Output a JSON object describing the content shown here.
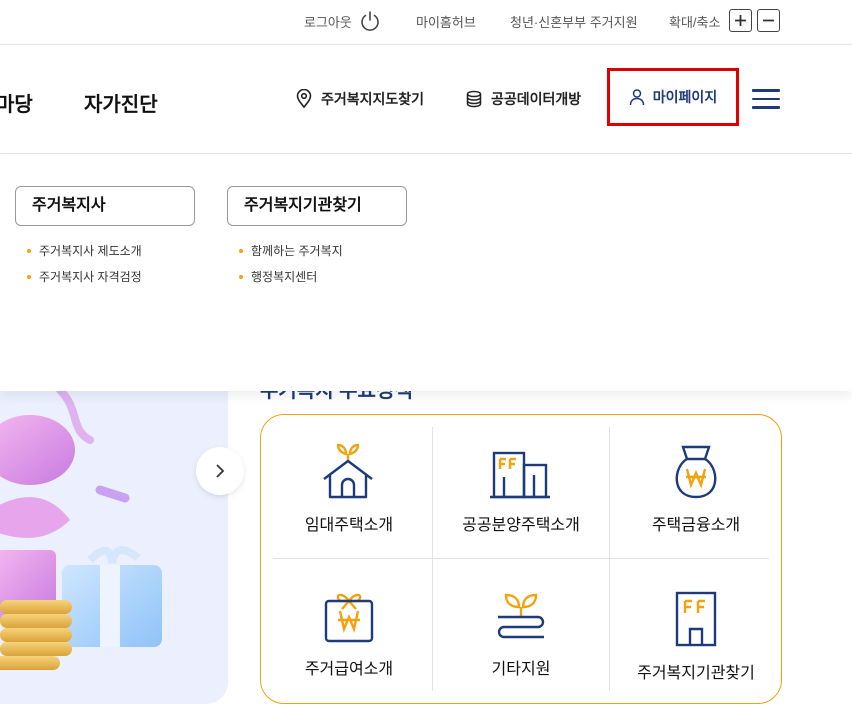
{
  "util_bar": {
    "logout": "로그아웃",
    "myhome_hub": "마이홈허브",
    "youth_support": "청년·신혼부부 주거지원",
    "zoom_label": "확대/축소"
  },
  "main_nav": {
    "left_cut": "마당",
    "self_diagnosis": "자가진단",
    "map_search": "주거복지지도찾기",
    "open_data": "공공데이터개방",
    "mypage": "마이페이지"
  },
  "dropdown": {
    "col1": {
      "title": "주거복지사",
      "items": [
        "주거복지사 제도소개",
        "주거복지사 자격검정"
      ]
    },
    "col2": {
      "title": "주거복지기관찾기",
      "items": [
        "함께하는 주거복지",
        "행정복지센터"
      ]
    }
  },
  "main": {
    "section_title": "주거복지 주요정책",
    "services": [
      {
        "icon": "house-icon",
        "label": "임대주택소개"
      },
      {
        "icon": "building-icon",
        "label": "공공분양주택소개"
      },
      {
        "icon": "money-bag-icon",
        "label": "주택금융소개"
      },
      {
        "icon": "gift-won-icon",
        "label": "주거급여소개"
      },
      {
        "icon": "sprout-icon",
        "label": "기타지원"
      },
      {
        "icon": "office-icon",
        "label": "주거복지기관찾기"
      }
    ]
  },
  "colors": {
    "navy": "#1d3a7a",
    "accent": "#f2a20c",
    "highlight": "#e00000"
  }
}
